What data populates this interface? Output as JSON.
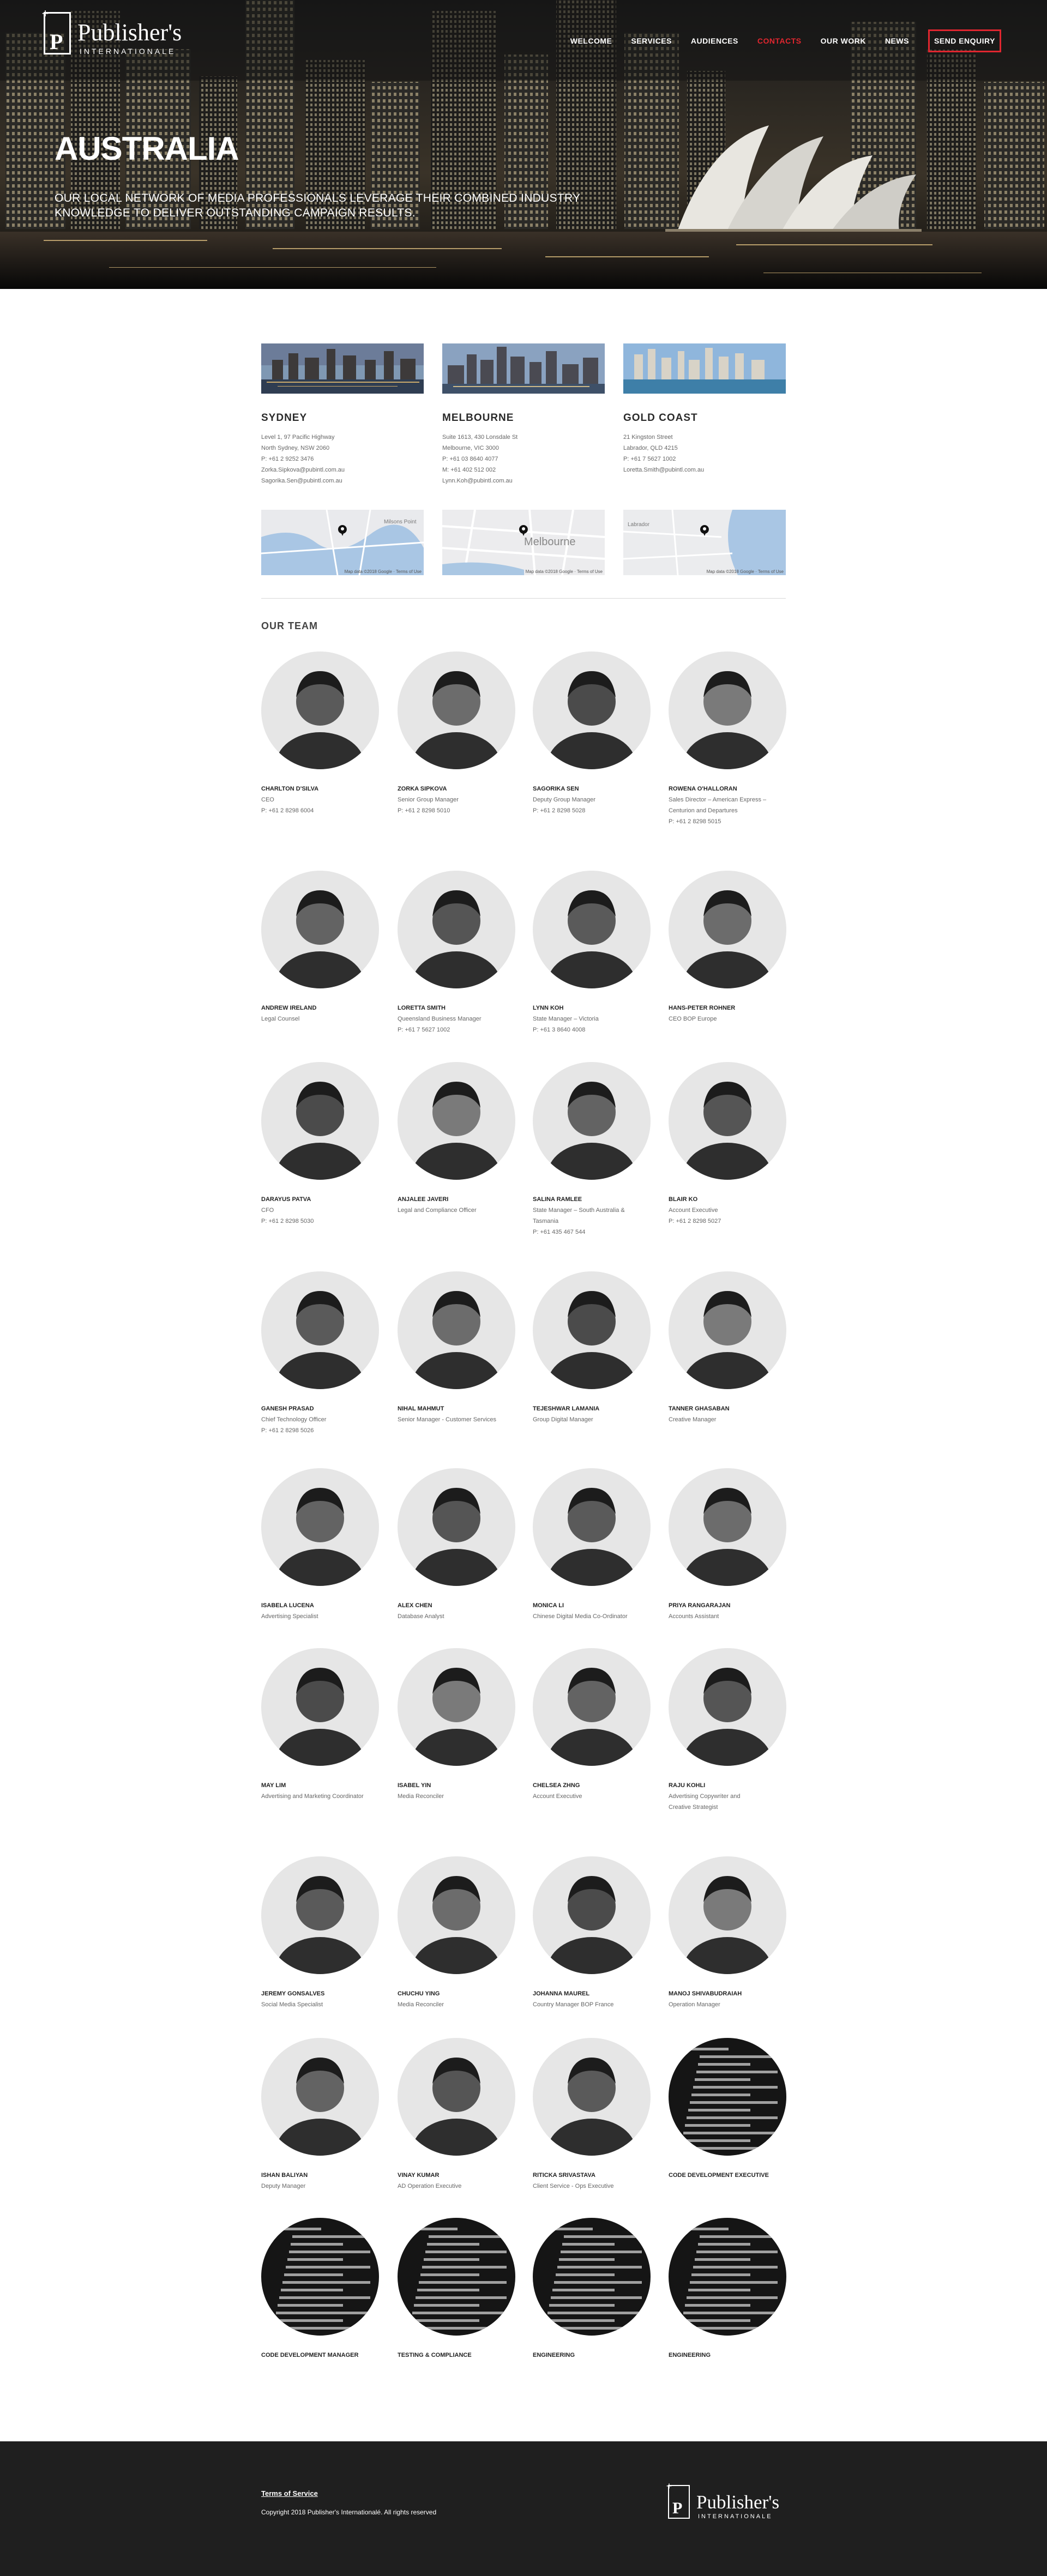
{
  "brand": {
    "name": "Publisher's",
    "tagline": "INTERNATIONALE",
    "mark": "P",
    "mark_plus": "+"
  },
  "nav": {
    "items": [
      {
        "label": "WELCOME"
      },
      {
        "label": "SERVICES"
      },
      {
        "label": "AUDIENCES"
      },
      {
        "label": "CONTACTS",
        "active": true
      },
      {
        "label": "OUR WORK"
      },
      {
        "label": "NEWS"
      }
    ],
    "cta": "SEND ENQUIRY"
  },
  "hero": {
    "title": "AUSTRALIA",
    "subtitle": "OUR LOCAL NETWORK OF MEDIA PROFESSIONALS LEVERAGE THEIR COMBINED INDUSTRY KNOWLEDGE TO DELIVER OUTSTANDING CAMPAIGN RESULTS."
  },
  "offices": [
    {
      "city": "SYDNEY",
      "lines": [
        "Level 1, 97 Pacific Highway",
        "North Sydney, NSW 2060",
        "P: +61 2 9252 3476",
        "Zorka.Sipkova@pubintl.com.au",
        "Sagorika.Sen@pubintl.com.au"
      ],
      "map_label": "Milsons Point"
    },
    {
      "city": "MELBOURNE",
      "lines": [
        "Suite 1613, 430 Lonsdale St",
        "Melbourne, VIC 3000",
        "P: +61 03 8640 4077",
        "M: +61 402 512 002",
        "Lynn.Koh@pubintl.com.au"
      ],
      "map_label": "Melbourne"
    },
    {
      "city": "GOLD COAST",
      "lines": [
        "21 Kingston Street",
        "Labrador, QLD 4215",
        "P: +61 7 5627 1002",
        "Loretta.Smith@pubintl.com.au"
      ],
      "map_label": "Labrador"
    }
  ],
  "map_attr": {
    "data": "Map data ©2018 Google",
    "terms": "Terms of Use"
  },
  "team": {
    "title": "OUR TEAM",
    "members": [
      {
        "name": "CHARLTON D'SILVA",
        "role": [
          "CEO",
          "P: +61 2 8298 6004"
        ]
      },
      {
        "name": "ZORKA SIPKOVA",
        "role": [
          "Senior Group Manager",
          "P: +61 2 8298 5010"
        ]
      },
      {
        "name": "SAGORIKA SEN",
        "role": [
          "Deputy Group Manager",
          "P: +61 2 8298 5028"
        ]
      },
      {
        "name": "ROWENA O'HALLORAN",
        "role": [
          "Sales Director – American Express –",
          "Centurion and Departures",
          "P: +61 2 8298 5015"
        ]
      },
      {
        "name": "ANDREW IRELAND",
        "role": [
          "Legal Counsel"
        ]
      },
      {
        "name": "LORETTA SMITH",
        "role": [
          "Queensland Business Manager",
          "P: +61 7 5627 1002"
        ]
      },
      {
        "name": "LYNN KOH",
        "role": [
          "State Manager – Victoria",
          "P: +61 3 8640 4008"
        ]
      },
      {
        "name": "HANS-PETER ROHNER",
        "role": [
          "CEO BOP Europe"
        ]
      },
      {
        "name": "DARAYUS PATVA",
        "role": [
          "CFO",
          "P: +61 2 8298 5030"
        ]
      },
      {
        "name": "ANJALEE JAVERI",
        "role": [
          "Legal and Compliance Officer"
        ]
      },
      {
        "name": "SALINA RAMLEE",
        "role": [
          "State Manager – South Australia &",
          "Tasmania",
          "P: +61 435 467 544"
        ]
      },
      {
        "name": "BLAIR KO",
        "role": [
          "Account Executive",
          "P: +61 2 8298 5027"
        ]
      },
      {
        "name": "GANESH PRASAD",
        "role": [
          "Chief Technology Officer",
          "P: +61 2 8298 5026"
        ]
      },
      {
        "name": "NIHAL MAHMUT",
        "role": [
          "Senior Manager - Customer Services"
        ]
      },
      {
        "name": "TEJESHWAR LAMANIA",
        "role": [
          "Group Digital Manager"
        ]
      },
      {
        "name": "TANNER GHASABAN",
        "role": [
          "Creative Manager"
        ]
      },
      {
        "name": "ISABELA LUCENA",
        "role": [
          "Advertising Specialist"
        ]
      },
      {
        "name": "ALEX CHEN",
        "role": [
          "Database Analyst"
        ]
      },
      {
        "name": "MONICA LI",
        "role": [
          "Chinese Digital Media Co-Ordinator"
        ]
      },
      {
        "name": "PRIYA RANGARAJAN",
        "role": [
          "Accounts Assistant"
        ]
      },
      {
        "name": "MAY LIM",
        "role": [
          "Advertising and Marketing Coordinator"
        ]
      },
      {
        "name": "ISABEL YIN",
        "role": [
          "Media Reconciler"
        ]
      },
      {
        "name": "CHELSEA ZHNG",
        "role": [
          "Account Executive"
        ]
      },
      {
        "name": "RAJU KOHLI",
        "role": [
          "Advertising Copywriter and",
          "Creative Strategist"
        ]
      },
      {
        "name": "JEREMY GONSALVES",
        "role": [
          "Social Media Specialist"
        ]
      },
      {
        "name": "CHUCHU YING",
        "role": [
          "Media Reconciler"
        ]
      },
      {
        "name": "JOHANNA MAUREL",
        "role": [
          "Country Manager BOP France"
        ]
      },
      {
        "name": "MANOJ SHIVABUDRAIAH",
        "role": [
          "Operation Manager"
        ]
      },
      {
        "name": "ISHAN BALIYAN",
        "role": [
          "Deputy Manager"
        ]
      },
      {
        "name": "VINAY KUMAR",
        "role": [
          "AD Operation Executive"
        ]
      },
      {
        "name": "RITICKA SRIVASTAVA",
        "role": [
          "Client Service - Ops Executive"
        ]
      },
      {
        "name": "CODE DEVELOPMENT EXECUTIVE",
        "role": []
      },
      {
        "name": "CODE DEVELOPMENT MANAGER",
        "role": []
      },
      {
        "name": "TESTING & COMPLIANCE",
        "role": []
      },
      {
        "name": "ENGINEERING",
        "role": []
      },
      {
        "name": "ENGINEERING",
        "role": []
      }
    ]
  },
  "footer": {
    "terms": "Terms of Service",
    "copyright": "Copyright 2018 Publisher's Internationalé. All rights reserved"
  }
}
